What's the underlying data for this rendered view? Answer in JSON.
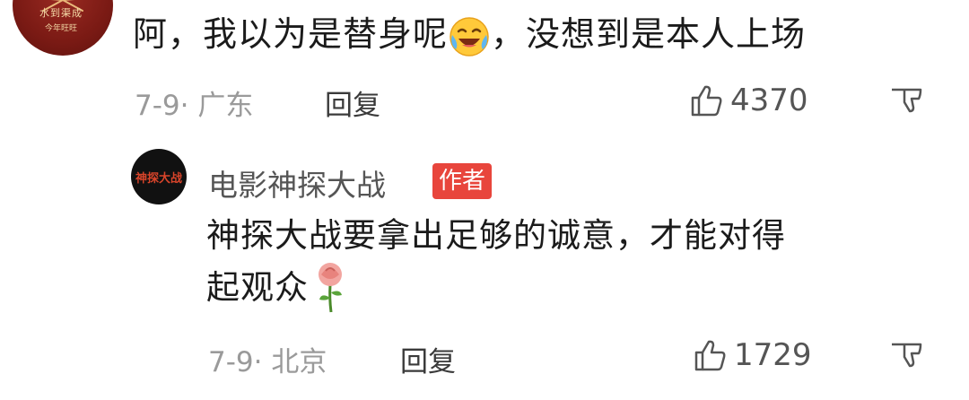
{
  "comment": {
    "avatar": {
      "line1": "水到渠成",
      "line2": "今年旺旺"
    },
    "text_before_emoji": "阿，我以为是替身呢",
    "emoji": "laughing-crying-emoji",
    "text_after_emoji": "，没想到是本人上场",
    "date_location": "7-9· 广东",
    "reply_label": "回复",
    "like_count": "4370"
  },
  "reply": {
    "avatar_text": "神探大战",
    "author_name": "电影神探大战",
    "author_badge": "作者",
    "text_line1": "神探大战要拿出足够的诚意，才能对得",
    "text_line2": "起观众",
    "emoji": "rose-emoji",
    "date_location": "7-9· 北京",
    "reply_label": "回复",
    "like_count": "1729"
  },
  "colors": {
    "badge": "#e8453c",
    "meta_text": "#9a9a9a"
  }
}
